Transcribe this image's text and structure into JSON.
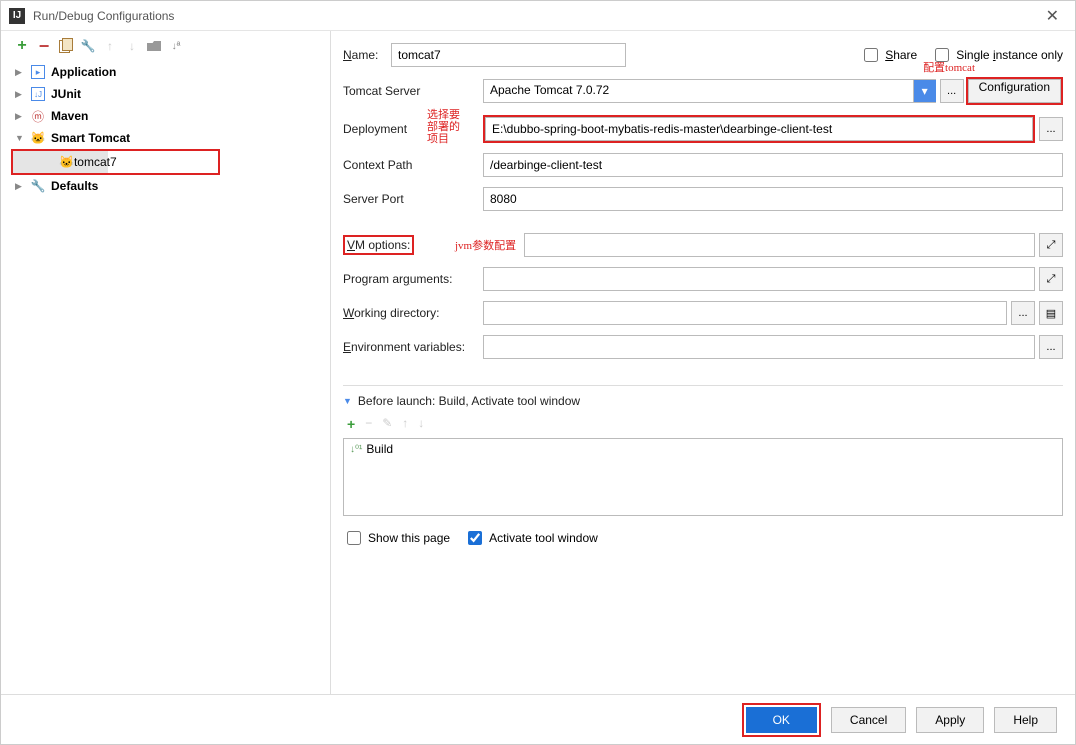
{
  "title": "Run/Debug Configurations",
  "sidebar": {
    "items": [
      {
        "label": "Application"
      },
      {
        "label": "JUnit"
      },
      {
        "label": "Maven"
      },
      {
        "label": "Smart Tomcat"
      },
      {
        "label": "Defaults"
      }
    ],
    "child": "tomcat7"
  },
  "form": {
    "name_label": "Name:",
    "name_value": "tomcat7",
    "share_label": "Share",
    "single_label": "Single instance only",
    "tomcat_label": "Tomcat Server",
    "tomcat_value": "Apache Tomcat 7.0.72",
    "config_btn": "Configuration",
    "deploy_label": "Deployment",
    "deploy_value": "E:\\dubbo-spring-boot-mybatis-redis-master\\dearbinge-client-test",
    "context_label": "Context Path",
    "context_value": "/dearbinge-client-test",
    "port_label": "Server Port",
    "port_value": "8080",
    "vm_label": "VM options:",
    "prog_label": "Program arguments:",
    "work_label": "Working directory:",
    "env_label": "Environment variables:",
    "launch_label": "Before launch: Build, Activate tool window",
    "build_item": "Build",
    "show_page": "Show this page",
    "activate_tw": "Activate tool window"
  },
  "anno": {
    "config": "配置tomcat",
    "deploy": "选择要\n部署的\n项目",
    "vm": "jvm参数配置"
  },
  "footer": {
    "ok": "OK",
    "cancel": "Cancel",
    "apply": "Apply",
    "help": "Help"
  }
}
